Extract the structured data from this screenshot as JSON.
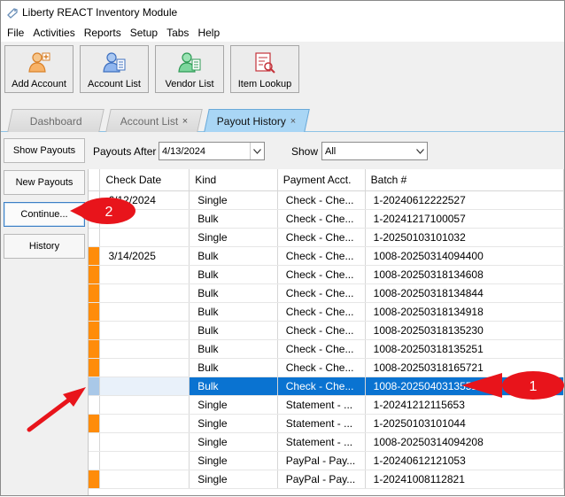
{
  "window": {
    "title": "Liberty REACT Inventory Module"
  },
  "menu": [
    "File",
    "Activities",
    "Reports",
    "Setup",
    "Tabs",
    "Help"
  ],
  "toolbar": [
    {
      "label": "Add Account",
      "icon": "add-account-icon"
    },
    {
      "label": "Account List",
      "icon": "account-list-icon"
    },
    {
      "label": "Vendor List",
      "icon": "vendor-list-icon"
    },
    {
      "label": "Item Lookup",
      "icon": "item-lookup-icon"
    }
  ],
  "tabs": [
    {
      "label": "Dashboard",
      "closable": false
    },
    {
      "label": "Account List",
      "closable": true,
      "close": "×"
    },
    {
      "label": "Payout History",
      "closable": true,
      "close": "×",
      "active": true
    }
  ],
  "side": [
    "Show Payouts",
    "New Payouts",
    "Continue...",
    "History"
  ],
  "filters": {
    "after_label": "Payouts After",
    "after_value": "4/13/2024",
    "show_label": "Show",
    "show_value": "All"
  },
  "columns": [
    "Check Date",
    "Kind",
    "Payment Acct.",
    "Batch #"
  ],
  "rows": [
    {
      "mark": "",
      "date": "6/12/2024",
      "kind": "Single",
      "acct": "Check - Che...",
      "batch": "1-20240612222527"
    },
    {
      "mark": "",
      "date": "",
      "kind": "Bulk",
      "acct": "Check - Che...",
      "batch": "1-20241217100057"
    },
    {
      "mark": "",
      "date": "",
      "kind": "Single",
      "acct": "Check - Che...",
      "batch": "1-20250103101032"
    },
    {
      "mark": "orange",
      "date": "3/14/2025",
      "kind": "Bulk",
      "acct": "Check - Che...",
      "batch": "1008-20250314094400"
    },
    {
      "mark": "orange",
      "date": "",
      "kind": "Bulk",
      "acct": "Check - Che...",
      "batch": "1008-20250318134608"
    },
    {
      "mark": "orange",
      "date": "",
      "kind": "Bulk",
      "acct": "Check - Che...",
      "batch": "1008-20250318134844"
    },
    {
      "mark": "orange",
      "date": "",
      "kind": "Bulk",
      "acct": "Check - Che...",
      "batch": "1008-20250318134918"
    },
    {
      "mark": "orange",
      "date": "",
      "kind": "Bulk",
      "acct": "Check - Che...",
      "batch": "1008-20250318135230"
    },
    {
      "mark": "orange",
      "date": "",
      "kind": "Bulk",
      "acct": "Check - Che...",
      "batch": "1008-20250318135251"
    },
    {
      "mark": "orange",
      "date": "",
      "kind": "Bulk",
      "acct": "Check - Che...",
      "batch": "1008-20250318165721"
    },
    {
      "mark": "",
      "date": "",
      "kind": "Bulk",
      "acct": "Check - Che...",
      "batch": "1008-20250403135518",
      "selected": true
    },
    {
      "mark": "",
      "date": "",
      "kind": "Single",
      "acct": "Statement - ...",
      "batch": "1-20241212115653"
    },
    {
      "mark": "orange",
      "date": "",
      "kind": "Single",
      "acct": "Statement - ...",
      "batch": "1-20250103101044"
    },
    {
      "mark": "",
      "date": "",
      "kind": "Single",
      "acct": "Statement - ...",
      "batch": "1008-20250314094208"
    },
    {
      "mark": "",
      "date": "",
      "kind": "Single",
      "acct": "PayPal - Pay...",
      "batch": "1-20240612121053"
    },
    {
      "mark": "orange",
      "date": "",
      "kind": "Single",
      "acct": "PayPal - Pay...",
      "batch": "1-20241008112821"
    }
  ],
  "callouts": [
    {
      "label": "1"
    },
    {
      "label": "2"
    }
  ],
  "colors": {
    "accent": "#0a73d1",
    "marker": "#ff8c0a",
    "callout": "#e8141b",
    "tab_active": "#a9d6f5"
  }
}
